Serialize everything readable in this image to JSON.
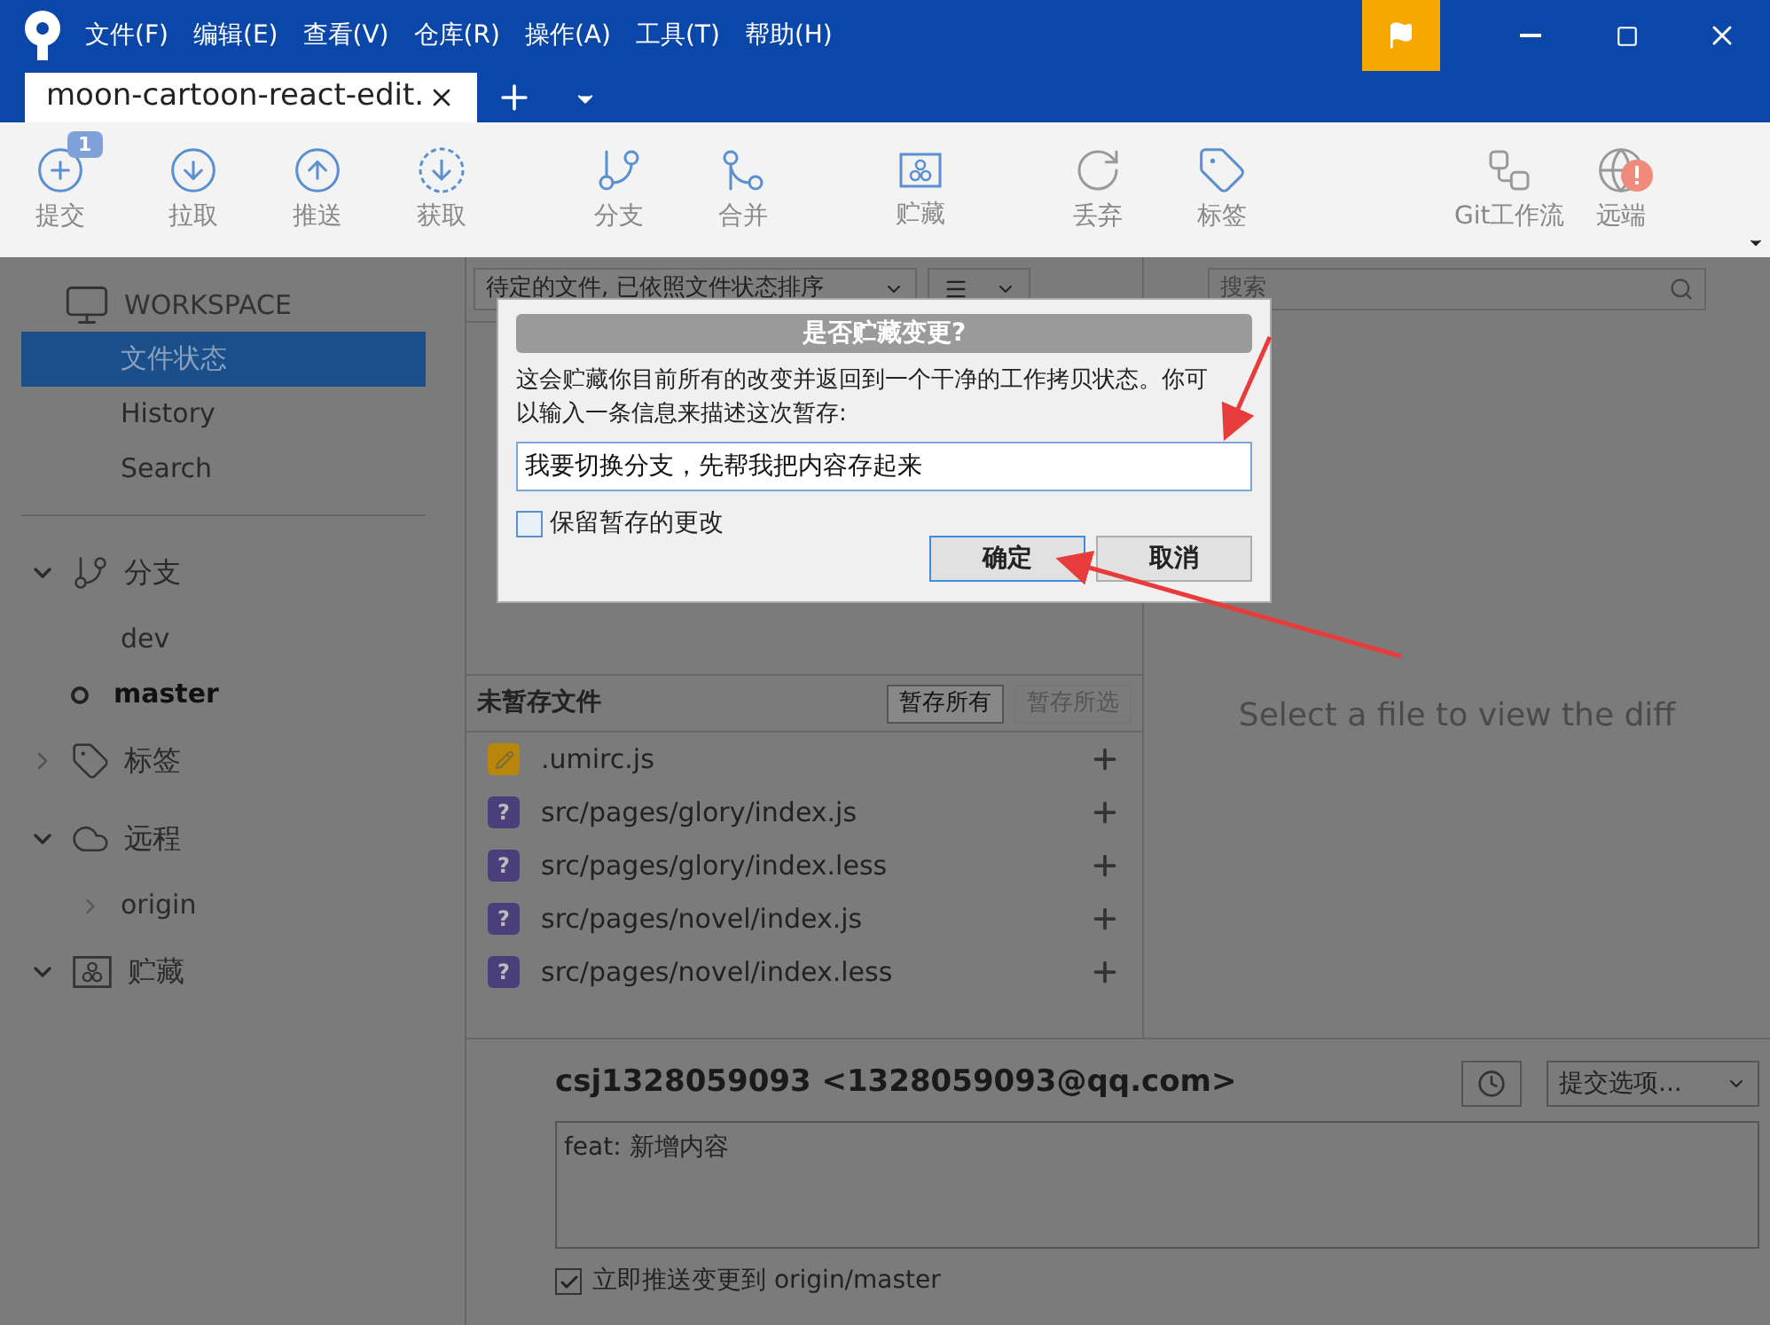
{
  "menu": [
    "文件(F)",
    "编辑(E)",
    "查看(V)",
    "仓库(R)",
    "操作(A)",
    "工具(T)",
    "帮助(H)"
  ],
  "tabs": [
    {
      "label": "moon-cartoon-react-edit.",
      "selected": true
    }
  ],
  "toolbar": [
    {
      "label": "提交",
      "badge": "1"
    },
    {
      "label": "拉取"
    },
    {
      "label": "推送"
    },
    {
      "label": "获取"
    },
    {
      "label": "分支"
    },
    {
      "label": "合并"
    },
    {
      "label": "贮藏"
    },
    {
      "label": "丢弃"
    },
    {
      "label": "标签"
    },
    {
      "label": "Git工作流"
    },
    {
      "label": "远端"
    }
  ],
  "sidebar": {
    "workspace": "WORKSPACE",
    "items": [
      {
        "label": "文件状态",
        "selected": true
      },
      {
        "label": "History",
        "selected": false
      },
      {
        "label": "Search",
        "selected": false
      }
    ],
    "sections": [
      {
        "label": "分支",
        "expanded": true,
        "children": [
          {
            "label": "dev",
            "current": false
          },
          {
            "label": "master",
            "current": true
          }
        ]
      },
      {
        "label": "标签",
        "expanded": false
      },
      {
        "label": "远程",
        "expanded": true,
        "children": [
          {
            "label": "origin",
            "current": false
          }
        ]
      },
      {
        "label": "贮藏",
        "expanded": true
      }
    ]
  },
  "filter": {
    "sort": "待定的文件, 已依照文件状态排序",
    "search_placeholder": "搜索"
  },
  "unstaged": {
    "title": "未暂存文件",
    "buttons": [
      {
        "label": "暂存所有",
        "disabled": false
      },
      {
        "label": "暂存所选",
        "disabled": true
      }
    ],
    "files": [
      {
        "name": ".umirc.js",
        "kind": "modified"
      },
      {
        "name": "src/pages/glory/index.js",
        "kind": "untracked",
        "glyph": "?"
      },
      {
        "name": "src/pages/glory/index.less",
        "kind": "untracked",
        "glyph": "?"
      },
      {
        "name": "src/pages/novel/index.js",
        "kind": "untracked",
        "glyph": "?"
      },
      {
        "name": "src/pages/novel/index.less",
        "kind": "untracked",
        "glyph": "?"
      }
    ]
  },
  "diff": {
    "empty_text": "Select a file to view the diff"
  },
  "commit": {
    "author": "csj1328059093 <1328059093@qq.com>",
    "options": "提交选项...",
    "message": "feat: 新增内容",
    "push": {
      "label": "立即推送变更到 origin/master",
      "checked": true
    }
  },
  "dialog": {
    "title": "是否贮藏变更?",
    "message": "这会贮藏你目前所有的改变并返回到一个干净的工作拷贝状态。你可以输入一条信息来描述这次暂存:",
    "input": "我要切换分支，先帮我把内容存起来",
    "keep": {
      "label": "保留暂存的更改",
      "checked": false
    },
    "buttons": [
      {
        "label": "确定",
        "default": true
      },
      {
        "label": "取消",
        "default": false
      }
    ]
  }
}
